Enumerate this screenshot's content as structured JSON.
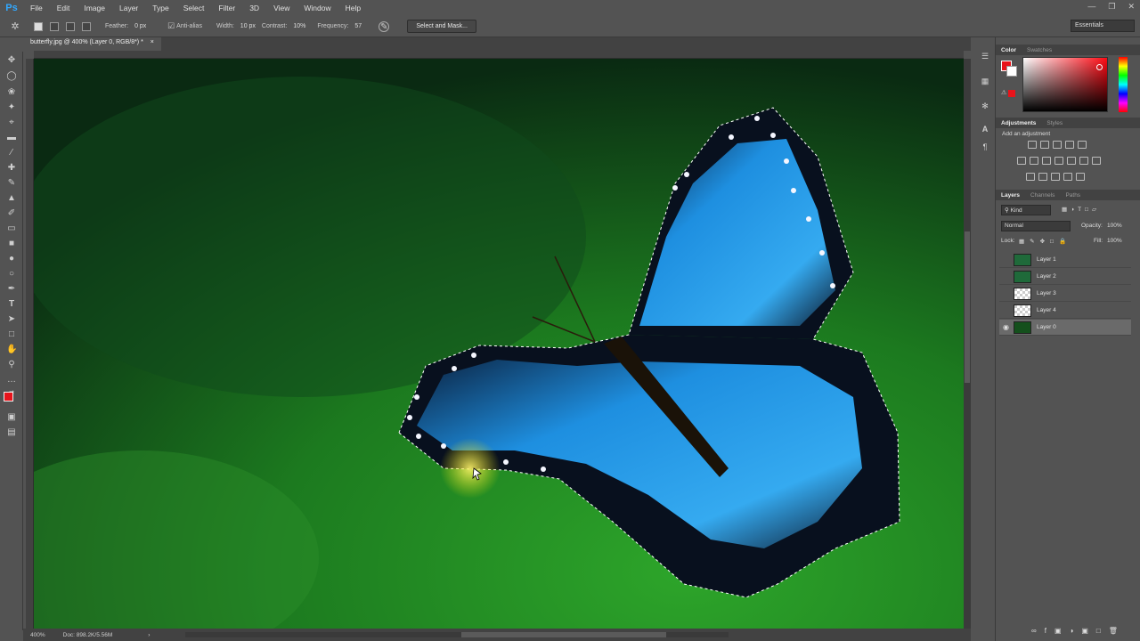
{
  "app": {
    "logo": "Ps"
  },
  "menu": [
    "File",
    "Edit",
    "Image",
    "Layer",
    "Type",
    "Select",
    "Filter",
    "3D",
    "View",
    "Window",
    "Help"
  ],
  "options": {
    "feather_label": "Feather:",
    "feather_value": "0 px",
    "antialias_label": "Anti-alias",
    "width_label": "Width:",
    "width_value": "10 px",
    "contrast_label": "Contrast:",
    "contrast_value": "10%",
    "frequency_label": "Frequency:",
    "frequency_value": "57",
    "select_mask": "Select and Mask...",
    "workspace": "Essentials"
  },
  "document": {
    "tab": "butterfly.jpg @ 400% (Layer 0, RGB/8*) *"
  },
  "status": {
    "zoom": "400%",
    "doc": "Doc: 898.2K/5.56M"
  },
  "panels": {
    "color_tabs": [
      "Color",
      "Swatches"
    ],
    "foreground": "#e8141b",
    "adj_tabs": [
      "Adjustments",
      "Styles"
    ],
    "adj_hint": "Add an adjustment",
    "layer_tabs": [
      "Layers",
      "Channels",
      "Paths"
    ],
    "kind": "Kind",
    "blend": "Normal",
    "opacity_label": "Opacity:",
    "opacity_value": "100%",
    "lock_label": "Lock:",
    "fill_label": "Fill:",
    "fill_value": "100%",
    "layers": [
      {
        "name": "Layer 1"
      },
      {
        "name": "Layer 2"
      },
      {
        "name": "Layer 3"
      },
      {
        "name": "Layer 4"
      },
      {
        "name": "Layer 0"
      }
    ]
  }
}
